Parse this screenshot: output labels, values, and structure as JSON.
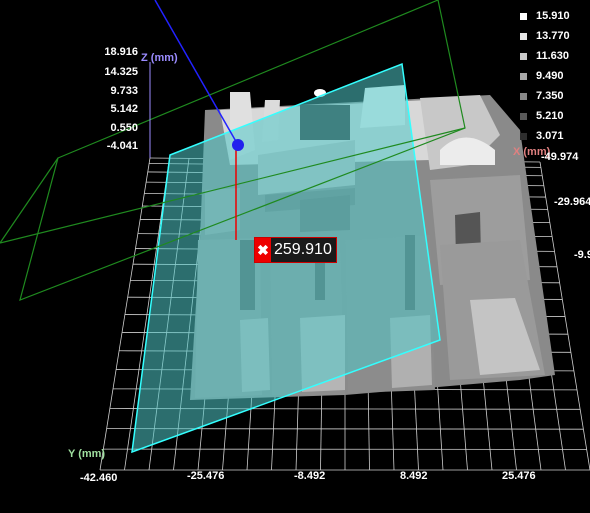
{
  "legend": {
    "items": [
      {
        "value": "15.910",
        "color": "#ffffff"
      },
      {
        "value": "13.770",
        "color": "#e6e6e6"
      },
      {
        "value": "11.630",
        "color": "#c9c9c9"
      },
      {
        "value": "9.490",
        "color": "#a8a8a8"
      },
      {
        "value": "7.350",
        "color": "#888888"
      },
      {
        "value": "5.210",
        "color": "#5a5a5a"
      },
      {
        "value": "3.071",
        "color": "#2e2e2e"
      }
    ]
  },
  "z_axis": {
    "title": "Z (mm)",
    "color": "#9b8cff",
    "ticks": [
      "18.916",
      "14.325",
      "9.733",
      "5.142",
      "0.550",
      "-4.041"
    ]
  },
  "x_axis": {
    "title": "X (mm)",
    "color": "#e08080",
    "ticks": [
      "-49.974",
      "-29.964",
      "-9.9"
    ]
  },
  "y_axis": {
    "title": "Y (mm)",
    "color": "#9fe09f",
    "ticks": [
      "-42.460",
      "-25.476",
      "-8.492",
      "8.492",
      "25.476"
    ]
  },
  "marker": {
    "icon": "close-icon",
    "value": "259.910"
  }
}
